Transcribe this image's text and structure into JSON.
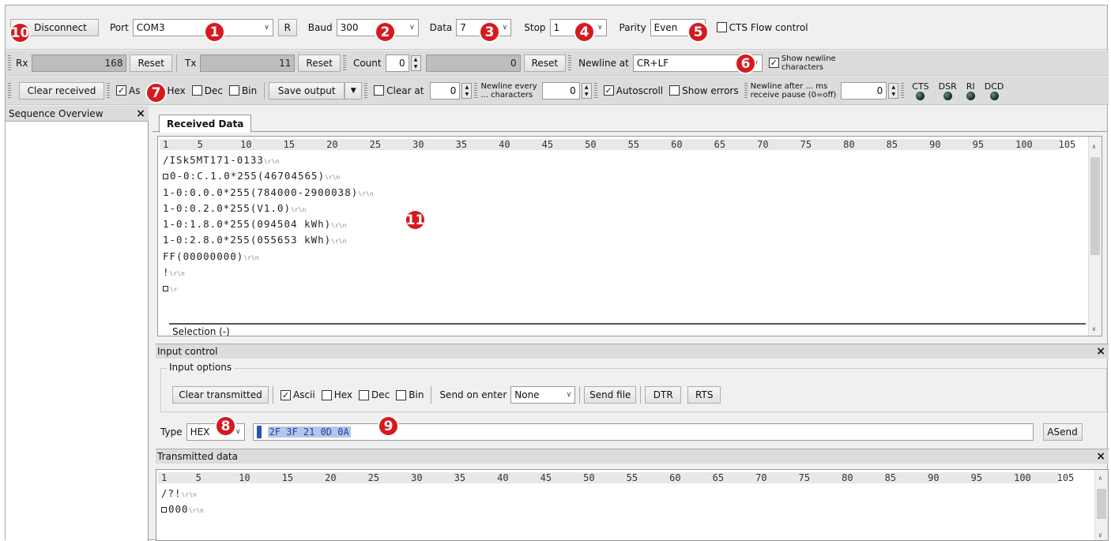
{
  "toolbar1": {
    "disconnect_label": "Disconnect",
    "port_label": "Port",
    "port_value": "COM3",
    "r_label": "R",
    "baud_label": "Baud",
    "baud_value": "300",
    "data_label": "Data",
    "data_value": "7",
    "stop_label": "Stop",
    "stop_value": "1",
    "parity_label": "Parity",
    "parity_value": "Even",
    "cts_label": "CTS Flow control"
  },
  "toolbar2": {
    "rx_label": "Rx",
    "rx_value": "168",
    "tx_label": "Tx",
    "tx_value": "11",
    "reset_label": "Reset",
    "count_label": "Count",
    "count_value": "0",
    "count_total": "0",
    "newline_at_label": "Newline at",
    "newline_at_value": "CR+LF",
    "show_newline_label_1": "Show newline",
    "show_newline_label_2": "characters"
  },
  "toolbar3": {
    "clear_received_label": "Clear received",
    "ascii_label": "As",
    "hex_label": "Hex",
    "dec_label": "Dec",
    "bin_label": "Bin",
    "save_output_label": "Save output",
    "clear_at_label": "Clear at",
    "clear_at_value": "0",
    "newline_every_1": "Newline every",
    "newline_every_2": "... characters",
    "newline_every_value": "0",
    "autoscroll_label": "Autoscroll",
    "show_errors_label": "Show errors",
    "newline_after_1": "Newline after ... ms",
    "newline_after_2": "receive pause (0=off)",
    "newline_after_value": "0",
    "leds": [
      "CTS",
      "DSR",
      "RI",
      "DCD"
    ]
  },
  "sequence": {
    "title": "Sequence Overview",
    "close": "×"
  },
  "received": {
    "tab_label": "Received Data",
    "ruler": [
      "1",
      "5",
      "10",
      "15",
      "20",
      "25",
      "30",
      "35",
      "40",
      "45",
      "50",
      "55",
      "60",
      "65",
      "70",
      "75",
      "80",
      "85",
      "90",
      "95",
      "100",
      "105"
    ],
    "lines": [
      {
        "prefix": "",
        "text": "/ISk5MT171-0133",
        "eol": "\\r\\n"
      },
      {
        "prefix": "sq",
        "text": "0-0:C.1.0*255(46704565)",
        "eol": "\\r\\n"
      },
      {
        "prefix": "",
        "text": "1-0:0.0.0*255(784000-2900038)",
        "eol": "\\r\\n"
      },
      {
        "prefix": "",
        "text": "1-0:0.2.0*255(V1.0)",
        "eol": "\\r\\n"
      },
      {
        "prefix": "",
        "text": "1-0:1.8.0*255(094504 kWh)",
        "eol": "\\r\\n"
      },
      {
        "prefix": "",
        "text": "1-0:2.8.0*255(055653 kWh)",
        "eol": "\\r\\n"
      },
      {
        "prefix": "",
        "text": "FF(00000000)",
        "eol": "\\r\\n"
      },
      {
        "prefix": "",
        "text": "!",
        "eol": "\\r\\n"
      },
      {
        "prefix": "sq",
        "text": "",
        "eol": "\\r"
      }
    ],
    "selection": "Selection (-)"
  },
  "input_control": {
    "title": "Input control",
    "options_title": "Input options",
    "clear_transmitted_label": "Clear transmitted",
    "ascii_label": "Ascii",
    "hex_label": "Hex",
    "dec_label": "Dec",
    "bin_label": "Bin",
    "send_on_enter_label": "Send on enter",
    "send_on_enter_value": "None",
    "send_file_label": "Send file",
    "dtr_label": "DTR",
    "rts_label": "RTS",
    "type_label": "Type",
    "type_value": "HEX",
    "input_value": "2F 3F 21 0D 0A",
    "asend_label": "ASend"
  },
  "transmitted": {
    "title": "Transmitted data",
    "lines": [
      {
        "prefix": "",
        "text": "/?!",
        "eol": "\\r\\n"
      },
      {
        "prefix": "sq",
        "text": "000",
        "eol": "\\r\\n"
      }
    ]
  },
  "badges": [
    "10",
    "1",
    "2",
    "3",
    "4",
    "5",
    "6",
    "7",
    "8",
    "9",
    "11"
  ],
  "colors": {
    "badge": "#d7191f",
    "selection": "#b5c6ea",
    "panel": "#dcdcdc"
  }
}
